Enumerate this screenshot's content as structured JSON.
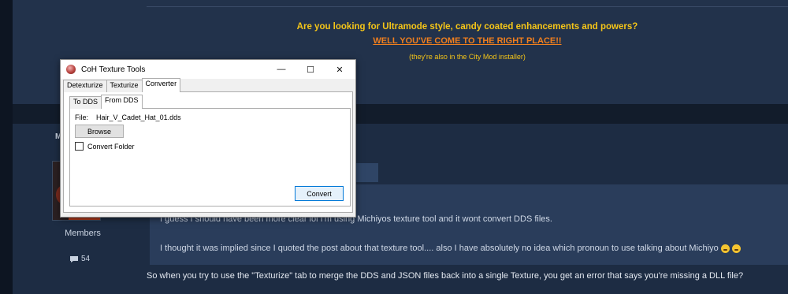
{
  "ad": {
    "line1": "Are you looking for Ultramode style, candy coated enhancements and powers?",
    "line2": "WELL YOU'VE COME TO THE RIGHT PLACE!!",
    "line3": "(they're also in the City Mod installer)"
  },
  "sidebar": {
    "section_letter": "M",
    "member_role": "Members",
    "post_count": "54"
  },
  "quote": {
    "line1": "I guess I should have been more clear lol I'm using Michiyos texture tool and it wont convert DDS files.",
    "line2": "I thought it was implied since I quoted the post about that texture tool.... also I have absolutely no idea which pronoun to use talking about Michiyo"
  },
  "reply": {
    "text": "So when you try to use the \"Texturize\" tab to merge the DDS and JSON files back into a single Texture, you get an error that says you're missing a DLL file?"
  },
  "window": {
    "title": "CoH Texture Tools",
    "controls": {
      "minimize": "—",
      "maximize": "☐",
      "close": "✕"
    },
    "tabs": [
      "Detexturize",
      "Texturize",
      "Converter"
    ],
    "selected_tab": "Converter",
    "subtabs": [
      "To DDS",
      "From DDS"
    ],
    "selected_subtab": "From DDS",
    "file_label": "File:",
    "file_value": "Hair_V_Cadet_Hat_01.dds",
    "browse_label": "Browse",
    "checkbox_label": "Convert Folder",
    "checkbox_checked": false,
    "convert_label": "Convert"
  },
  "colors": {
    "ad_yellow": "#f5c518",
    "ad_orange": "#f07f1e",
    "accent_blue": "#0078d7"
  }
}
